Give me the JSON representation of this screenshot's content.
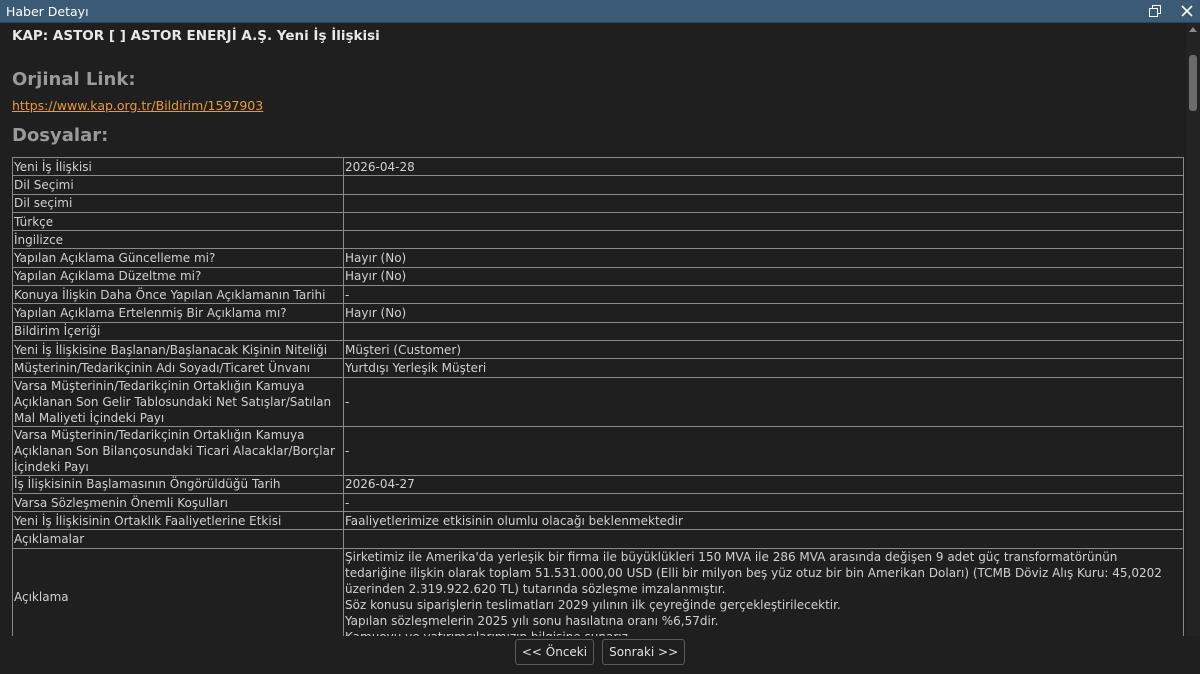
{
  "window": {
    "title": "Haber Detayı"
  },
  "news": {
    "title": "KAP: ASTOR [ ] ASTOR ENERJİ A.Ş. Yeni İş İlişkisi",
    "link_heading": "Orjinal Link:",
    "link_url": "https://www.kap.org.tr/Bildirim/1597903",
    "files_heading": "Dosyalar:"
  },
  "table": {
    "rows": [
      {
        "key": "Yeni İş İlişkisi",
        "value": "2026-04-28"
      },
      {
        "key": "Dil Seçimi",
        "value": ""
      },
      {
        "key": "Dil seçimi",
        "value": ""
      },
      {
        "key": "Türkçe",
        "value": ""
      },
      {
        "key": "İngilizce",
        "value": ""
      },
      {
        "key": "Yapılan Açıklama Güncelleme mi?",
        "value": "Hayır (No)"
      },
      {
        "key": "Yapılan Açıklama Düzeltme mi?",
        "value": "Hayır (No)"
      },
      {
        "key": "Konuya İlişkin Daha Önce Yapılan Açıklamanın Tarihi",
        "value": "-"
      },
      {
        "key": "Yapılan Açıklama Ertelenmiş Bir Açıklama mı?",
        "value": "Hayır (No)"
      },
      {
        "key": "Bildirim İçeriği",
        "value": ""
      },
      {
        "key": "Yeni İş İlişkisine Başlanan/Başlanacak Kişinin Niteliği",
        "value": "Müşteri (Customer)"
      },
      {
        "key": "Müşterinin/Tedarikçinin Adı Soyadı/Ticaret Ünvanı",
        "value": "Yurtdışı Yerleşik Müşteri"
      },
      {
        "key": "Varsa Müşterinin/Tedarikçinin Ortaklığın Kamuya Açıklanan Son Gelir Tablosundaki Net Satışlar/Satılan Mal Maliyeti İçindeki Payı",
        "value": "-"
      },
      {
        "key": "Varsa Müşterinin/Tedarikçinin Ortaklığın Kamuya Açıklanan Son Bilançosundaki Ticari Alacaklar/Borçlar İçindeki Payı",
        "value": "-"
      },
      {
        "key": "İş İlişkisinin Başlamasının Öngörüldüğü Tarih",
        "value": "2026-04-27"
      },
      {
        "key": "Varsa Sözleşmenin Önemli Koşulları",
        "value": "-"
      },
      {
        "key": "Yeni İş İlişkisinin Ortaklık Faaliyetlerine Etkisi",
        "value": "Faaliyetlerimize etkisinin olumlu olacağı beklenmektedir"
      },
      {
        "key": "Açıklamalar",
        "value": ""
      }
    ],
    "explanation": {
      "key": "Açıklama",
      "lines": [
        "Şirketimiz ile Amerika'da yerleşik bir firma ile büyüklükleri 150 MVA ile 286 MVA arasında değişen 9 adet güç transformatörünün tedariğine ilişkin olarak toplam 51.531.000,00 USD (Elli bir milyon beş yüz otuz bir bin Amerikan Doları) (TCMB Döviz Alış Kuru: 45,0202 üzerinden 2.319.922.620 TL) tutarında sözleşme imzalanmıştır.",
        "Söz konusu siparişlerin teslimatları 2029 yılının ilk çeyreğinde gerçekleştirilecektir.",
        "Yapılan sözleşmelerin 2025 yılı sonu hasılatına oranı %6,57dir.",
        "Kamuoyu ve yatırımcılarımızın bilgisine sunarız."
      ]
    }
  },
  "footer": {
    "prev_label": "<< Önceki",
    "next_label": "Sonraki >>"
  },
  "colors": {
    "titlebar": "#3a5a75",
    "background": "#1f1f1f",
    "link": "#e89a3c"
  }
}
